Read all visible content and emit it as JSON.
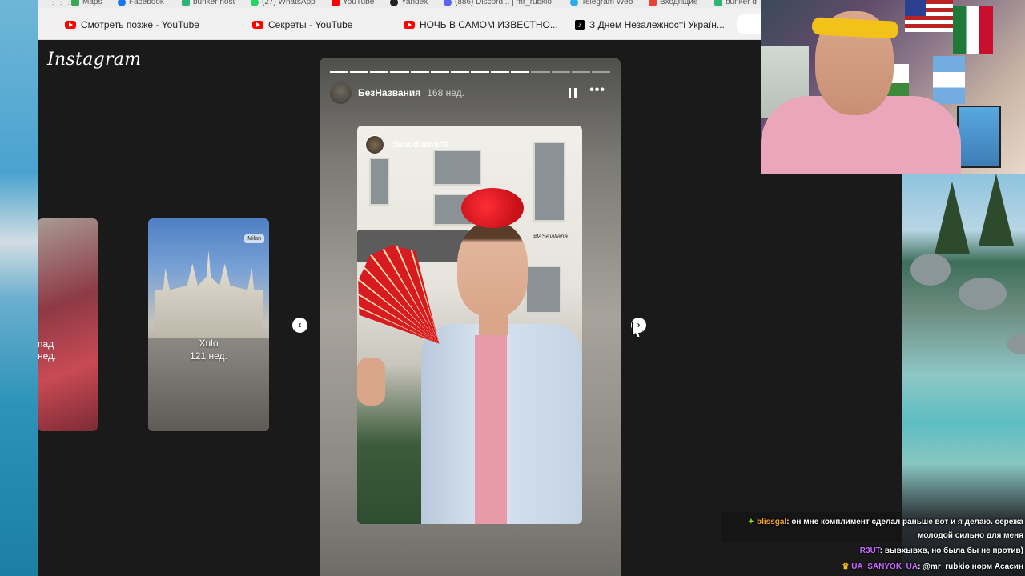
{
  "bookmarks": [
    {
      "label": "Maps",
      "color": "#34a853"
    },
    {
      "label": "Facebook",
      "color": "#1877f2"
    },
    {
      "label": "bunker host",
      "color": "#2bb673"
    },
    {
      "label": "(27) WhatsApp",
      "color": "#25d366"
    },
    {
      "label": "YouTube",
      "color": "#ff0000"
    },
    {
      "label": "Yandex",
      "color": "#222222"
    },
    {
      "label": "(886) Discord... | mr_rubkio",
      "color": "#5865f2"
    },
    {
      "label": "Telegram Web",
      "color": "#2aabee"
    },
    {
      "label": "Входящие",
      "color": "#ea4335"
    },
    {
      "label": "bunker d",
      "color": "#2bb673"
    }
  ],
  "tabs": [
    {
      "label": "Смотреть позже - YouTube",
      "icon": "youtube-icon"
    },
    {
      "label": "Секреты - YouTube",
      "icon": "youtube-icon"
    },
    {
      "label": "НОЧЬ В САМОМ ИЗВЕСТНО...",
      "icon": "youtube-icon"
    },
    {
      "label": "З Днем Незалежності Україн...",
      "icon": "tiktok-icon"
    }
  ],
  "instagram": {
    "logo": "Instagram",
    "side_cards": [
      {
        "label_line1": "пад",
        "label_line2": "нед."
      },
      {
        "name": "Xulo",
        "time": "121 нед.",
        "location": "Milan"
      }
    ],
    "story": {
      "username": "БезНазвания",
      "time": "168 нед.",
      "progress_total": 14,
      "progress_done": 10,
      "more_label": "•••",
      "photo_user": "claaudiamarti",
      "photo_tag": "#laSevillana"
    },
    "prev_label": "‹",
    "next_label": "›"
  },
  "chat": [
    {
      "user": "blissgal",
      "user_color": "#f5a623",
      "text": ": он мне комплимент сделал раньше вот и я делаю. сережа"
    },
    {
      "user": "",
      "user_color": "#ffffff",
      "text": "молодой сильно для меня"
    },
    {
      "user": "R3UT",
      "user_color": "#c86bff",
      "text": ": вывхывхв, но была бы не против)"
    },
    {
      "user": "UA_SANYOK_UA",
      "user_color": "#c86bff",
      "text": ": @mr_rubkio норм Асасин"
    }
  ]
}
